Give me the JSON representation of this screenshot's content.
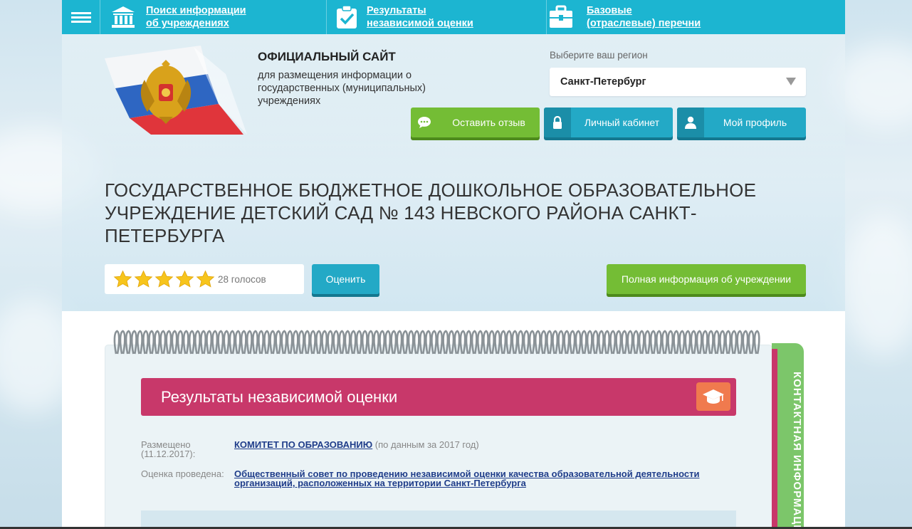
{
  "nav": {
    "items": [
      {
        "line1": "Поиск информации",
        "line2": "об учреждениях"
      },
      {
        "line1": "Результаты",
        "line2": "независимой оценки"
      },
      {
        "line1": "Базовые",
        "line2": "(отраслевые) перечни"
      }
    ]
  },
  "header": {
    "site_title": "ОФИЦИАЛЬНЫЙ САЙТ",
    "site_desc": "для размещения информации о государственных (муниципальных) учреждениях",
    "region_label": "Выберите ваш регион",
    "region_value": "Санкт-Петербург",
    "btn_feedback": "Оставить отзыв",
    "btn_cabinet": "Личный кабинет",
    "btn_profile": "Мой профиль"
  },
  "org": {
    "title": "ГОСУДАРСТВЕННОЕ БЮДЖЕТНОЕ ДОШКОЛЬНОЕ ОБРАЗОВАТЕЛЬНОЕ УЧРЕЖДЕНИЕ ДЕТСКИЙ САД № 143 НЕВСКОГО РАЙОНА САНКТ-ПЕТЕРБУРГА",
    "rating_stars": 5,
    "votes": "28 голосов",
    "btn_rate": "Оценить",
    "btn_fullinfo": "Полная информация об учреждении"
  },
  "results": {
    "banner_title": "Результаты независимой оценки",
    "posted_label": "Размещено (11.12.2017):",
    "posted_link": "КОМИТЕТ ПО ОБРАЗОВАНИЮ",
    "posted_note": " (по данным за 2017 год)",
    "conducted_label": "Оценка проведена:",
    "conducted_link": "Общественный совет по проведению независимой оценки качества образовательной деятельности организаций, расположенных на территории Санкт-Петербурга"
  },
  "contact_tab": "КОНТАКТНАЯ ИНФОРМАЦИЯ",
  "colors": {
    "accent_blue": "#1cb5d1",
    "green": "#74bd35",
    "pink": "#c8386a",
    "orange": "#f07a4e"
  }
}
